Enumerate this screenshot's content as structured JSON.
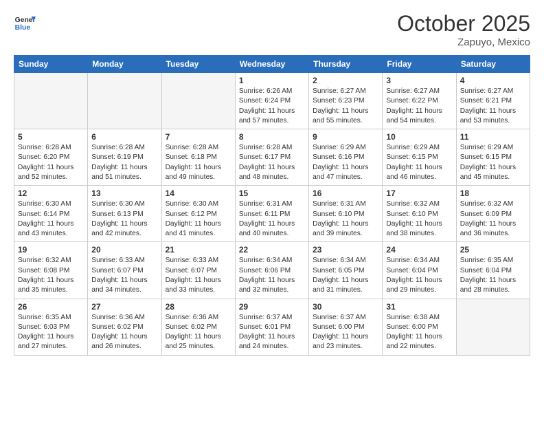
{
  "header": {
    "logo_line1": "General",
    "logo_line2": "Blue",
    "month": "October 2025",
    "location": "Zapuyo, Mexico"
  },
  "weekdays": [
    "Sunday",
    "Monday",
    "Tuesday",
    "Wednesday",
    "Thursday",
    "Friday",
    "Saturday"
  ],
  "weeks": [
    [
      {
        "day": "",
        "sunrise": "",
        "sunset": "",
        "daylight": ""
      },
      {
        "day": "",
        "sunrise": "",
        "sunset": "",
        "daylight": ""
      },
      {
        "day": "",
        "sunrise": "",
        "sunset": "",
        "daylight": ""
      },
      {
        "day": "1",
        "sunrise": "Sunrise: 6:26 AM",
        "sunset": "Sunset: 6:24 PM",
        "daylight": "Daylight: 11 hours and 57 minutes."
      },
      {
        "day": "2",
        "sunrise": "Sunrise: 6:27 AM",
        "sunset": "Sunset: 6:23 PM",
        "daylight": "Daylight: 11 hours and 55 minutes."
      },
      {
        "day": "3",
        "sunrise": "Sunrise: 6:27 AM",
        "sunset": "Sunset: 6:22 PM",
        "daylight": "Daylight: 11 hours and 54 minutes."
      },
      {
        "day": "4",
        "sunrise": "Sunrise: 6:27 AM",
        "sunset": "Sunset: 6:21 PM",
        "daylight": "Daylight: 11 hours and 53 minutes."
      }
    ],
    [
      {
        "day": "5",
        "sunrise": "Sunrise: 6:28 AM",
        "sunset": "Sunset: 6:20 PM",
        "daylight": "Daylight: 11 hours and 52 minutes."
      },
      {
        "day": "6",
        "sunrise": "Sunrise: 6:28 AM",
        "sunset": "Sunset: 6:19 PM",
        "daylight": "Daylight: 11 hours and 51 minutes."
      },
      {
        "day": "7",
        "sunrise": "Sunrise: 6:28 AM",
        "sunset": "Sunset: 6:18 PM",
        "daylight": "Daylight: 11 hours and 49 minutes."
      },
      {
        "day": "8",
        "sunrise": "Sunrise: 6:28 AM",
        "sunset": "Sunset: 6:17 PM",
        "daylight": "Daylight: 11 hours and 48 minutes."
      },
      {
        "day": "9",
        "sunrise": "Sunrise: 6:29 AM",
        "sunset": "Sunset: 6:16 PM",
        "daylight": "Daylight: 11 hours and 47 minutes."
      },
      {
        "day": "10",
        "sunrise": "Sunrise: 6:29 AM",
        "sunset": "Sunset: 6:15 PM",
        "daylight": "Daylight: 11 hours and 46 minutes."
      },
      {
        "day": "11",
        "sunrise": "Sunrise: 6:29 AM",
        "sunset": "Sunset: 6:15 PM",
        "daylight": "Daylight: 11 hours and 45 minutes."
      }
    ],
    [
      {
        "day": "12",
        "sunrise": "Sunrise: 6:30 AM",
        "sunset": "Sunset: 6:14 PM",
        "daylight": "Daylight: 11 hours and 43 minutes."
      },
      {
        "day": "13",
        "sunrise": "Sunrise: 6:30 AM",
        "sunset": "Sunset: 6:13 PM",
        "daylight": "Daylight: 11 hours and 42 minutes."
      },
      {
        "day": "14",
        "sunrise": "Sunrise: 6:30 AM",
        "sunset": "Sunset: 6:12 PM",
        "daylight": "Daylight: 11 hours and 41 minutes."
      },
      {
        "day": "15",
        "sunrise": "Sunrise: 6:31 AM",
        "sunset": "Sunset: 6:11 PM",
        "daylight": "Daylight: 11 hours and 40 minutes."
      },
      {
        "day": "16",
        "sunrise": "Sunrise: 6:31 AM",
        "sunset": "Sunset: 6:10 PM",
        "daylight": "Daylight: 11 hours and 39 minutes."
      },
      {
        "day": "17",
        "sunrise": "Sunrise: 6:32 AM",
        "sunset": "Sunset: 6:10 PM",
        "daylight": "Daylight: 11 hours and 38 minutes."
      },
      {
        "day": "18",
        "sunrise": "Sunrise: 6:32 AM",
        "sunset": "Sunset: 6:09 PM",
        "daylight": "Daylight: 11 hours and 36 minutes."
      }
    ],
    [
      {
        "day": "19",
        "sunrise": "Sunrise: 6:32 AM",
        "sunset": "Sunset: 6:08 PM",
        "daylight": "Daylight: 11 hours and 35 minutes."
      },
      {
        "day": "20",
        "sunrise": "Sunrise: 6:33 AM",
        "sunset": "Sunset: 6:07 PM",
        "daylight": "Daylight: 11 hours and 34 minutes."
      },
      {
        "day": "21",
        "sunrise": "Sunrise: 6:33 AM",
        "sunset": "Sunset: 6:07 PM",
        "daylight": "Daylight: 11 hours and 33 minutes."
      },
      {
        "day": "22",
        "sunrise": "Sunrise: 6:34 AM",
        "sunset": "Sunset: 6:06 PM",
        "daylight": "Daylight: 11 hours and 32 minutes."
      },
      {
        "day": "23",
        "sunrise": "Sunrise: 6:34 AM",
        "sunset": "Sunset: 6:05 PM",
        "daylight": "Daylight: 11 hours and 31 minutes."
      },
      {
        "day": "24",
        "sunrise": "Sunrise: 6:34 AM",
        "sunset": "Sunset: 6:04 PM",
        "daylight": "Daylight: 11 hours and 29 minutes."
      },
      {
        "day": "25",
        "sunrise": "Sunrise: 6:35 AM",
        "sunset": "Sunset: 6:04 PM",
        "daylight": "Daylight: 11 hours and 28 minutes."
      }
    ],
    [
      {
        "day": "26",
        "sunrise": "Sunrise: 6:35 AM",
        "sunset": "Sunset: 6:03 PM",
        "daylight": "Daylight: 11 hours and 27 minutes."
      },
      {
        "day": "27",
        "sunrise": "Sunrise: 6:36 AM",
        "sunset": "Sunset: 6:02 PM",
        "daylight": "Daylight: 11 hours and 26 minutes."
      },
      {
        "day": "28",
        "sunrise": "Sunrise: 6:36 AM",
        "sunset": "Sunset: 6:02 PM",
        "daylight": "Daylight: 11 hours and 25 minutes."
      },
      {
        "day": "29",
        "sunrise": "Sunrise: 6:37 AM",
        "sunset": "Sunset: 6:01 PM",
        "daylight": "Daylight: 11 hours and 24 minutes."
      },
      {
        "day": "30",
        "sunrise": "Sunrise: 6:37 AM",
        "sunset": "Sunset: 6:00 PM",
        "daylight": "Daylight: 11 hours and 23 minutes."
      },
      {
        "day": "31",
        "sunrise": "Sunrise: 6:38 AM",
        "sunset": "Sunset: 6:00 PM",
        "daylight": "Daylight: 11 hours and 22 minutes."
      },
      {
        "day": "",
        "sunrise": "",
        "sunset": "",
        "daylight": ""
      }
    ]
  ]
}
